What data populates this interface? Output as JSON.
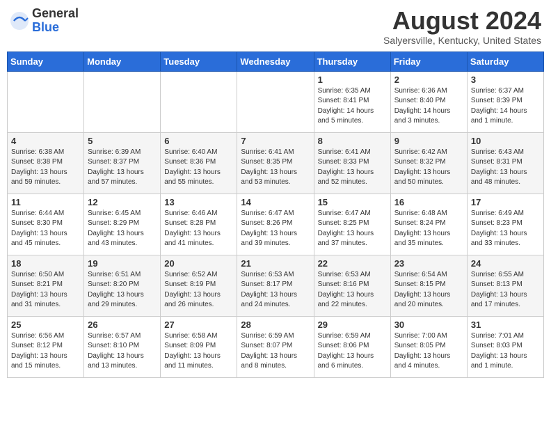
{
  "header": {
    "logo_general": "General",
    "logo_blue": "Blue",
    "month_year": "August 2024",
    "location": "Salyersville, Kentucky, United States"
  },
  "days_of_week": [
    "Sunday",
    "Monday",
    "Tuesday",
    "Wednesday",
    "Thursday",
    "Friday",
    "Saturday"
  ],
  "weeks": [
    [
      {
        "day": "",
        "info": ""
      },
      {
        "day": "",
        "info": ""
      },
      {
        "day": "",
        "info": ""
      },
      {
        "day": "",
        "info": ""
      },
      {
        "day": "1",
        "info": "Sunrise: 6:35 AM\nSunset: 8:41 PM\nDaylight: 14 hours\nand 5 minutes."
      },
      {
        "day": "2",
        "info": "Sunrise: 6:36 AM\nSunset: 8:40 PM\nDaylight: 14 hours\nand 3 minutes."
      },
      {
        "day": "3",
        "info": "Sunrise: 6:37 AM\nSunset: 8:39 PM\nDaylight: 14 hours\nand 1 minute."
      }
    ],
    [
      {
        "day": "4",
        "info": "Sunrise: 6:38 AM\nSunset: 8:38 PM\nDaylight: 13 hours\nand 59 minutes."
      },
      {
        "day": "5",
        "info": "Sunrise: 6:39 AM\nSunset: 8:37 PM\nDaylight: 13 hours\nand 57 minutes."
      },
      {
        "day": "6",
        "info": "Sunrise: 6:40 AM\nSunset: 8:36 PM\nDaylight: 13 hours\nand 55 minutes."
      },
      {
        "day": "7",
        "info": "Sunrise: 6:41 AM\nSunset: 8:35 PM\nDaylight: 13 hours\nand 53 minutes."
      },
      {
        "day": "8",
        "info": "Sunrise: 6:41 AM\nSunset: 8:33 PM\nDaylight: 13 hours\nand 52 minutes."
      },
      {
        "day": "9",
        "info": "Sunrise: 6:42 AM\nSunset: 8:32 PM\nDaylight: 13 hours\nand 50 minutes."
      },
      {
        "day": "10",
        "info": "Sunrise: 6:43 AM\nSunset: 8:31 PM\nDaylight: 13 hours\nand 48 minutes."
      }
    ],
    [
      {
        "day": "11",
        "info": "Sunrise: 6:44 AM\nSunset: 8:30 PM\nDaylight: 13 hours\nand 45 minutes."
      },
      {
        "day": "12",
        "info": "Sunrise: 6:45 AM\nSunset: 8:29 PM\nDaylight: 13 hours\nand 43 minutes."
      },
      {
        "day": "13",
        "info": "Sunrise: 6:46 AM\nSunset: 8:28 PM\nDaylight: 13 hours\nand 41 minutes."
      },
      {
        "day": "14",
        "info": "Sunrise: 6:47 AM\nSunset: 8:26 PM\nDaylight: 13 hours\nand 39 minutes."
      },
      {
        "day": "15",
        "info": "Sunrise: 6:47 AM\nSunset: 8:25 PM\nDaylight: 13 hours\nand 37 minutes."
      },
      {
        "day": "16",
        "info": "Sunrise: 6:48 AM\nSunset: 8:24 PM\nDaylight: 13 hours\nand 35 minutes."
      },
      {
        "day": "17",
        "info": "Sunrise: 6:49 AM\nSunset: 8:23 PM\nDaylight: 13 hours\nand 33 minutes."
      }
    ],
    [
      {
        "day": "18",
        "info": "Sunrise: 6:50 AM\nSunset: 8:21 PM\nDaylight: 13 hours\nand 31 minutes."
      },
      {
        "day": "19",
        "info": "Sunrise: 6:51 AM\nSunset: 8:20 PM\nDaylight: 13 hours\nand 29 minutes."
      },
      {
        "day": "20",
        "info": "Sunrise: 6:52 AM\nSunset: 8:19 PM\nDaylight: 13 hours\nand 26 minutes."
      },
      {
        "day": "21",
        "info": "Sunrise: 6:53 AM\nSunset: 8:17 PM\nDaylight: 13 hours\nand 24 minutes."
      },
      {
        "day": "22",
        "info": "Sunrise: 6:53 AM\nSunset: 8:16 PM\nDaylight: 13 hours\nand 22 minutes."
      },
      {
        "day": "23",
        "info": "Sunrise: 6:54 AM\nSunset: 8:15 PM\nDaylight: 13 hours\nand 20 minutes."
      },
      {
        "day": "24",
        "info": "Sunrise: 6:55 AM\nSunset: 8:13 PM\nDaylight: 13 hours\nand 17 minutes."
      }
    ],
    [
      {
        "day": "25",
        "info": "Sunrise: 6:56 AM\nSunset: 8:12 PM\nDaylight: 13 hours\nand 15 minutes."
      },
      {
        "day": "26",
        "info": "Sunrise: 6:57 AM\nSunset: 8:10 PM\nDaylight: 13 hours\nand 13 minutes."
      },
      {
        "day": "27",
        "info": "Sunrise: 6:58 AM\nSunset: 8:09 PM\nDaylight: 13 hours\nand 11 minutes."
      },
      {
        "day": "28",
        "info": "Sunrise: 6:59 AM\nSunset: 8:07 PM\nDaylight: 13 hours\nand 8 minutes."
      },
      {
        "day": "29",
        "info": "Sunrise: 6:59 AM\nSunset: 8:06 PM\nDaylight: 13 hours\nand 6 minutes."
      },
      {
        "day": "30",
        "info": "Sunrise: 7:00 AM\nSunset: 8:05 PM\nDaylight: 13 hours\nand 4 minutes."
      },
      {
        "day": "31",
        "info": "Sunrise: 7:01 AM\nSunset: 8:03 PM\nDaylight: 13 hours\nand 1 minute."
      }
    ]
  ]
}
